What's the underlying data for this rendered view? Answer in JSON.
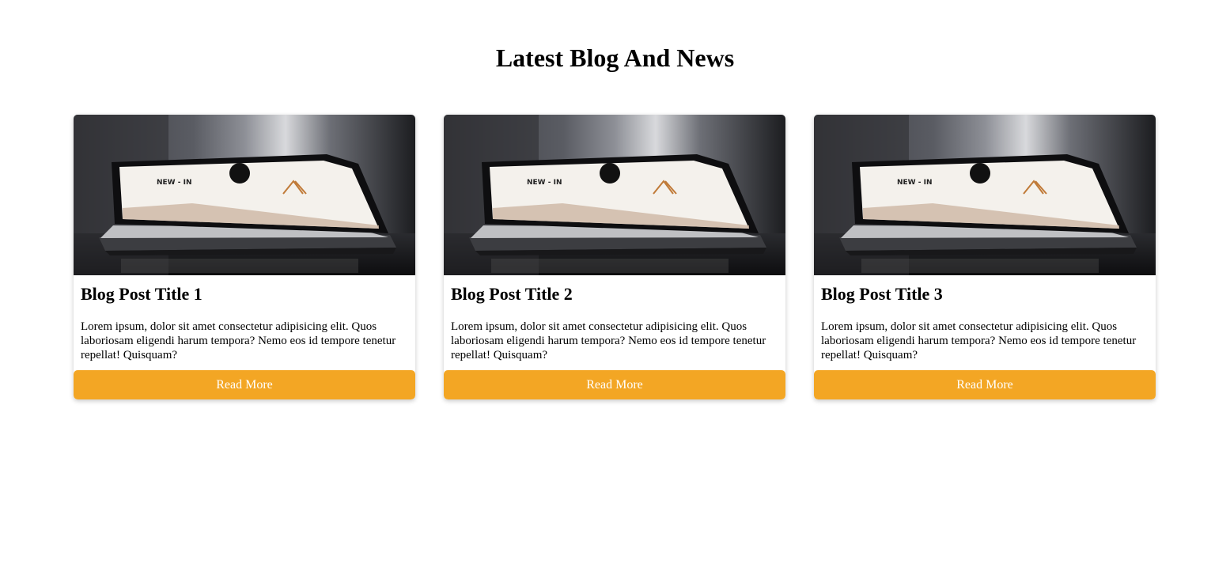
{
  "section": {
    "title": "Latest Blog And News"
  },
  "posts": [
    {
      "title": "Blog Post Title 1",
      "excerpt": "Lorem ipsum, dolor sit amet consectetur adipisicing elit. Quos laboriosam eligendi harum tempora? Nemo eos id tempore tenetur repellat! Quisquam?",
      "button_label": "Read More",
      "image_screen_text": "NEW - IN"
    },
    {
      "title": "Blog Post Title 2",
      "excerpt": "Lorem ipsum, dolor sit amet consectetur adipisicing elit. Quos laboriosam eligendi harum tempora? Nemo eos id tempore tenetur repellat! Quisquam?",
      "button_label": "Read More",
      "image_screen_text": "NEW - IN"
    },
    {
      "title": "Blog Post Title 3",
      "excerpt": "Lorem ipsum, dolor sit amet consectetur adipisicing elit. Quos laboriosam eligendi harum tempora? Nemo eos id tempore tenetur repellat! Quisquam?",
      "button_label": "Read More",
      "image_screen_text": "NEW - IN"
    }
  ],
  "colors": {
    "button": "#f3a624",
    "button_text": "#ffffff",
    "heading": "#000000"
  }
}
